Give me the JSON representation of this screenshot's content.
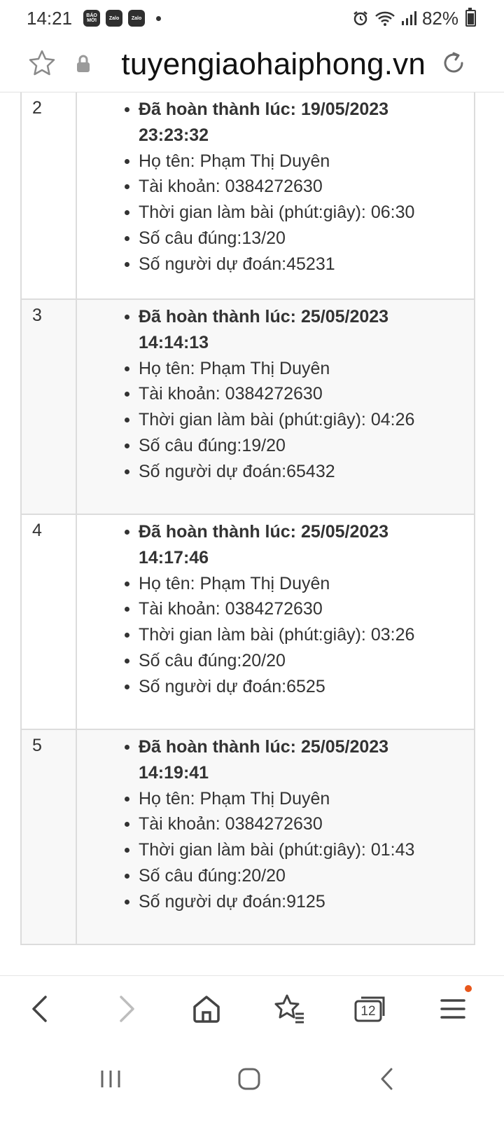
{
  "status_bar": {
    "time": "14:21",
    "app_badges": [
      "BÁO MỚI",
      "Zalo",
      "Zalo"
    ],
    "battery": "82%",
    "icons": [
      "alarm-icon",
      "wifi-icon",
      "signal-icon",
      "battery-icon"
    ]
  },
  "url_bar": {
    "url": "tuyengiaohaiphong.vn"
  },
  "rows": [
    {
      "index": "2",
      "completed": "Đã hoàn thành lúc: 19/05/2023",
      "completed_time": "23:23:32",
      "name": "Họ tên: Phạm Thị Duyên",
      "account": "Tài khoản: 0384272630",
      "duration": "Thời gian làm bài (phút:giây): 06:30",
      "correct": "Số câu đúng:13/20",
      "prediction": "Số người dự đoán:45231"
    },
    {
      "index": "3",
      "completed": "Đã hoàn thành lúc: 25/05/2023",
      "completed_time": "14:14:13",
      "name": "Họ tên: Phạm Thị Duyên",
      "account": "Tài khoản: 0384272630",
      "duration": "Thời gian làm bài (phút:giây): 04:26",
      "correct": "Số câu đúng:19/20",
      "prediction": "Số người dự đoán:65432"
    },
    {
      "index": "4",
      "completed": "Đã hoàn thành lúc: 25/05/2023",
      "completed_time": "14:17:46",
      "name": "Họ tên: Phạm Thị Duyên",
      "account": "Tài khoản: 0384272630",
      "duration": "Thời gian làm bài (phút:giây): 03:26",
      "correct": "Số câu đúng:20/20",
      "prediction": "Số người dự đoán:6525"
    },
    {
      "index": "5",
      "completed": "Đã hoàn thành lúc: 25/05/2023",
      "completed_time": "14:19:41",
      "name": "Họ tên: Phạm Thị Duyên",
      "account": "Tài khoản: 0384272630",
      "duration": "Thời gian làm bài (phút:giây): 01:43",
      "correct": "Số câu đúng:20/20",
      "prediction": "Số người dự đoán:9125"
    }
  ],
  "browser_nav": {
    "tab_count": "12",
    "menu_has_notification": true,
    "notification_color": "#e8571b"
  }
}
